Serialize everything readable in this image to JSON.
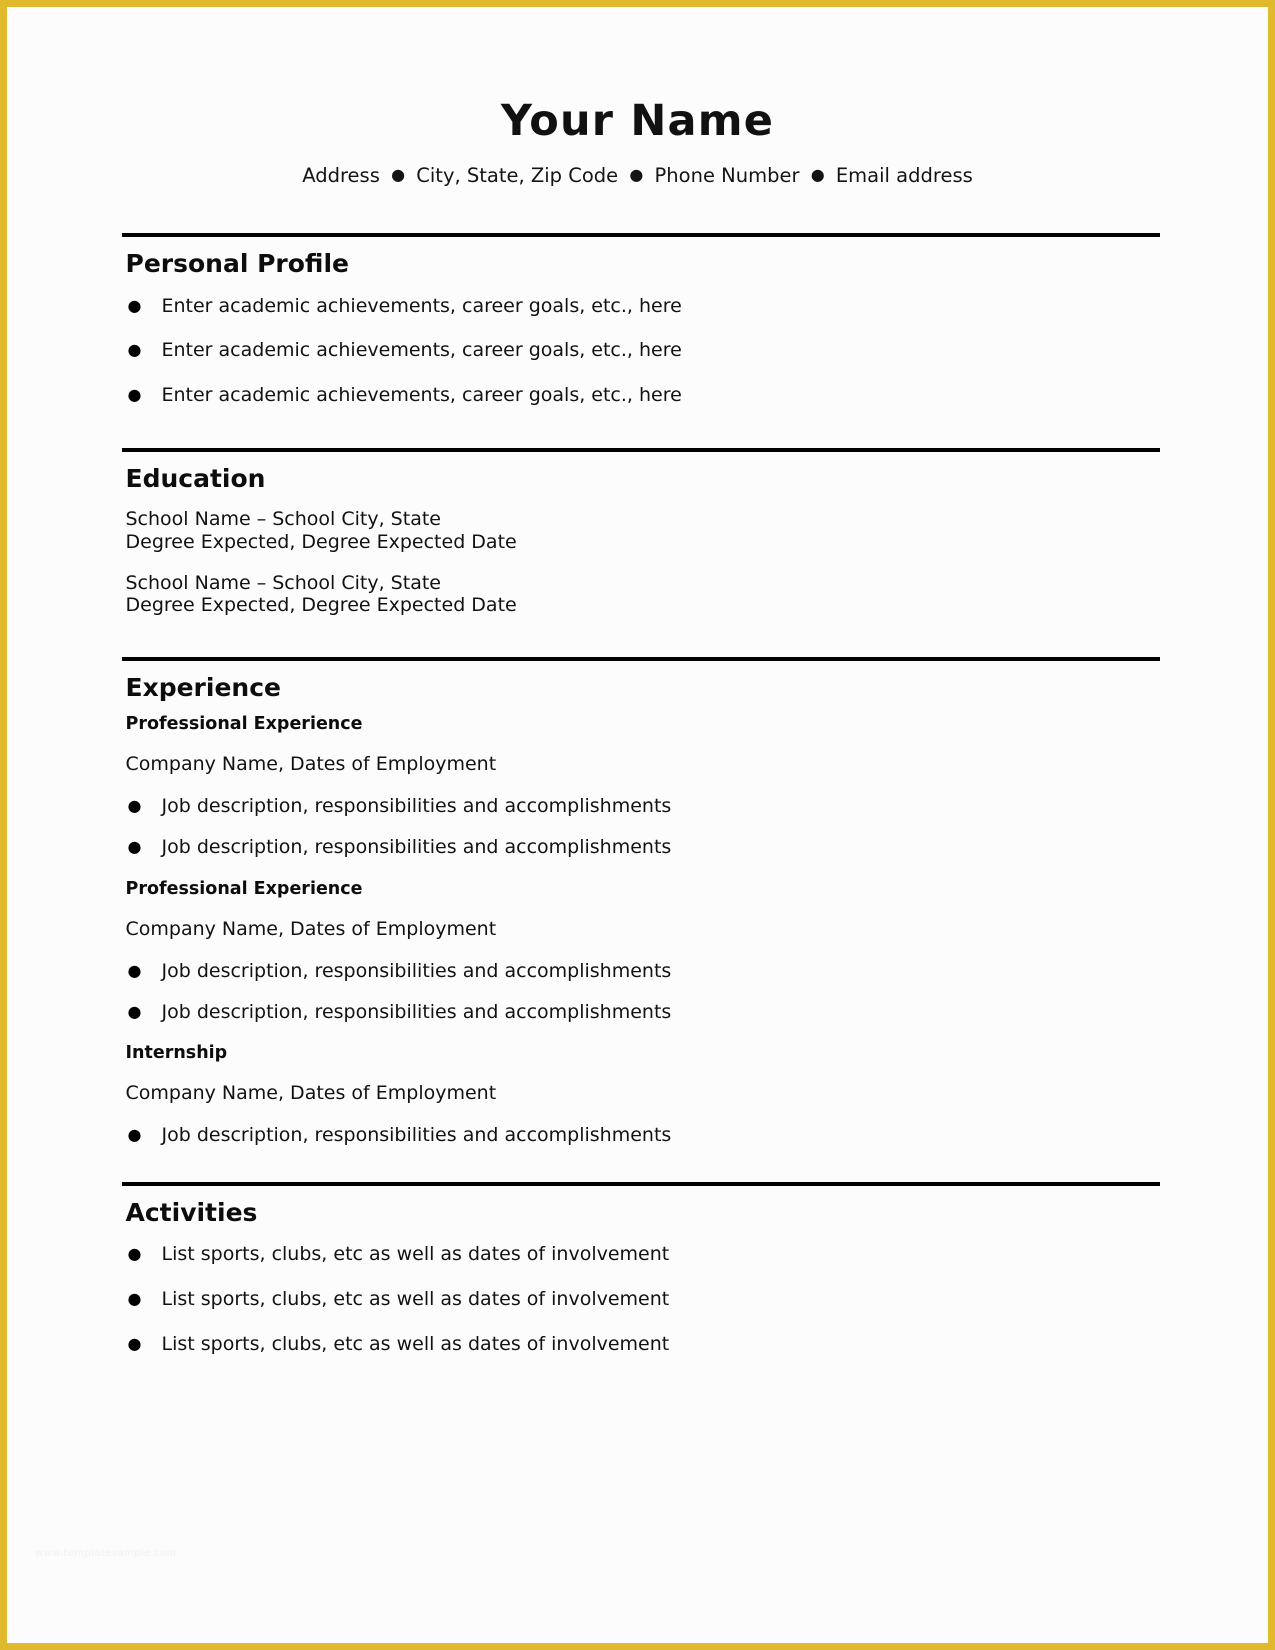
{
  "document": {
    "frame_color": "#e0b92c",
    "page_background": "#fcfcfc",
    "rule_color": "#000000"
  },
  "header": {
    "name": "Your Name",
    "contact": {
      "separator": "●",
      "items": [
        "Address",
        "City, State, Zip Code",
        "Phone Number",
        "Email address"
      ]
    }
  },
  "sections": {
    "personal_profile": {
      "title": "Personal Profile",
      "bullets": [
        "Enter academic achievements, career goals, etc., here",
        "Enter academic achievements, career goals, etc., here",
        "Enter academic achievements, career goals, etc., here"
      ]
    },
    "education": {
      "title": "Education",
      "entries": [
        {
          "school": "School Name – School City, State",
          "degree": "Degree Expected, Degree Expected Date"
        },
        {
          "school": "School Name – School City, State",
          "degree": "Degree Expected, Degree Expected Date"
        }
      ]
    },
    "experience": {
      "title": "Experience",
      "entries": [
        {
          "subtitle": "Professional Experience",
          "company": "Company Name, Dates of Employment",
          "bullets": [
            "Job description, responsibilities and accomplishments",
            "Job description, responsibilities and accomplishments"
          ]
        },
        {
          "subtitle": "Professional Experience",
          "company": "Company Name, Dates of Employment",
          "bullets": [
            "Job description, responsibilities and accomplishments",
            "Job description, responsibilities and accomplishments"
          ]
        },
        {
          "subtitle": "Internship",
          "company": "Company Name, Dates of Employment",
          "bullets": [
            "Job description, responsibilities and accomplishments"
          ]
        }
      ]
    },
    "activities": {
      "title": "Activities",
      "bullets": [
        "List sports, clubs, etc as well as dates of involvement",
        "List sports, clubs, etc as well as dates of involvement",
        "List sports, clubs, etc as well as dates of involvement"
      ]
    }
  },
  "watermark": {
    "text": "www.templatesample.com"
  }
}
